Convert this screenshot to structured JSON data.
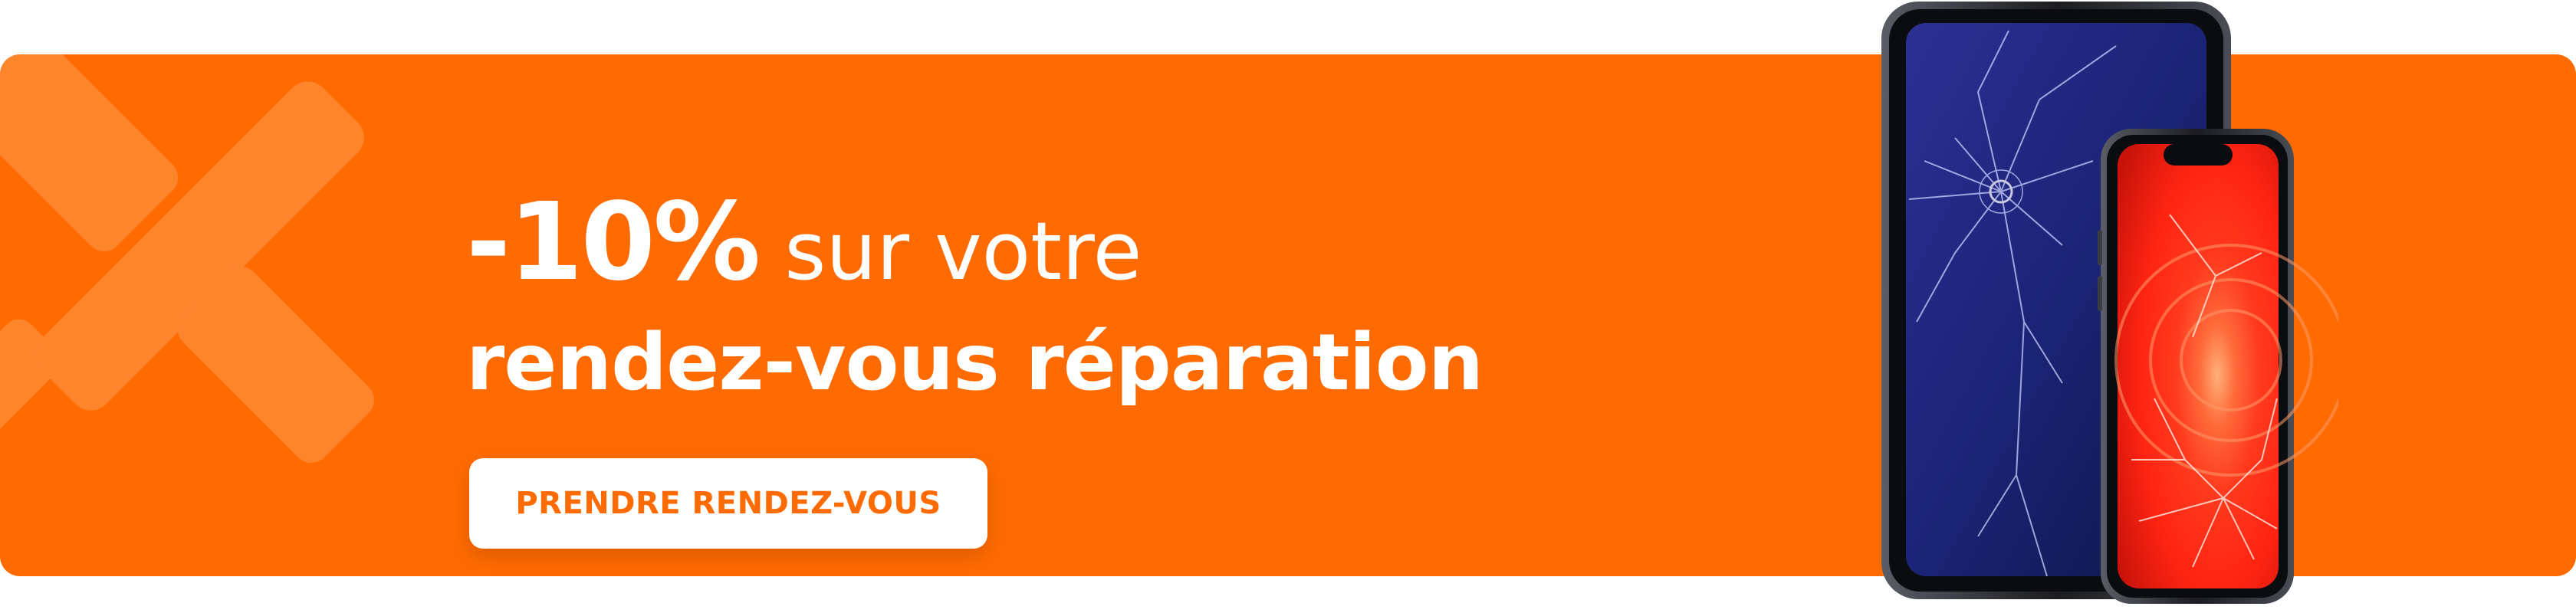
{
  "promo": {
    "discount": "-10%",
    "line1_rest": "sur votre",
    "line2": "rendez-vous réparation",
    "cta_label": "PRENDRE RENDEZ-VOUS"
  },
  "colors": {
    "brand_orange": "#ff6b00",
    "deco_orange": "#ff8c3a",
    "white": "#ffffff"
  },
  "icons": {
    "brand_mark": "x-logo-icon",
    "devices": "cracked-tablet-and-phone-illustration"
  }
}
